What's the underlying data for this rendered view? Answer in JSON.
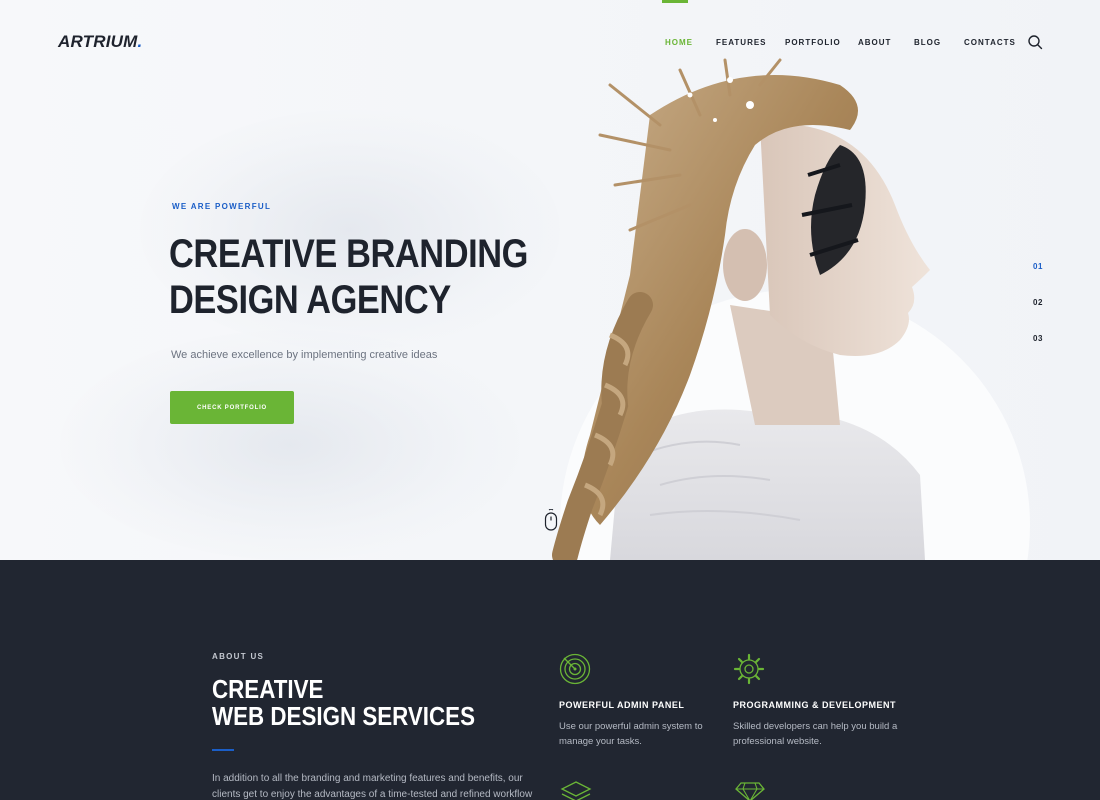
{
  "brand": {
    "name": "ARTRIUM",
    "dot": ".",
    "accent": "#6ab536",
    "blue": "#1b5ec7"
  },
  "nav": {
    "items": [
      {
        "label": "HOME",
        "active": true
      },
      {
        "label": "FEATURES",
        "active": false
      },
      {
        "label": "PORTFOLIO",
        "active": false
      },
      {
        "label": "ABOUT",
        "active": false
      },
      {
        "label": "BLOG",
        "active": false
      },
      {
        "label": "CONTACTS",
        "active": false
      }
    ],
    "search_icon": "search-icon"
  },
  "hero": {
    "eyebrow": "WE ARE POWERFUL",
    "headline_line1": "CREATIVE BRANDING",
    "headline_line2": "DESIGN AGENCY",
    "subtitle": "We achieve excellence by implementing creative ideas",
    "cta_label": "CHECK PORTFOLIO",
    "slides": [
      "01",
      "02",
      "03"
    ],
    "active_slide": "01",
    "scroll_icon": "mouse-icon"
  },
  "about": {
    "label": "ABOUT US",
    "heading_line1": "CREATIVE",
    "heading_line2": "WEB DESIGN SERVICES",
    "text": "In addition to all the branding and marketing features and benefits, our clients get to enjoy the advantages of a time-tested and refined workflow that is",
    "features": [
      {
        "icon": "radar-icon",
        "title": "POWERFUL ADMIN PANEL",
        "desc": "Use our powerful admin system to manage your tasks."
      },
      {
        "icon": "gear-icon",
        "title": "PROGRAMMING & DEVELOPMENT",
        "desc": "Skilled developers can help you build a professional website."
      },
      {
        "icon": "layers-icon",
        "title": "",
        "desc": ""
      },
      {
        "icon": "diamond-icon",
        "title": "",
        "desc": ""
      }
    ]
  }
}
